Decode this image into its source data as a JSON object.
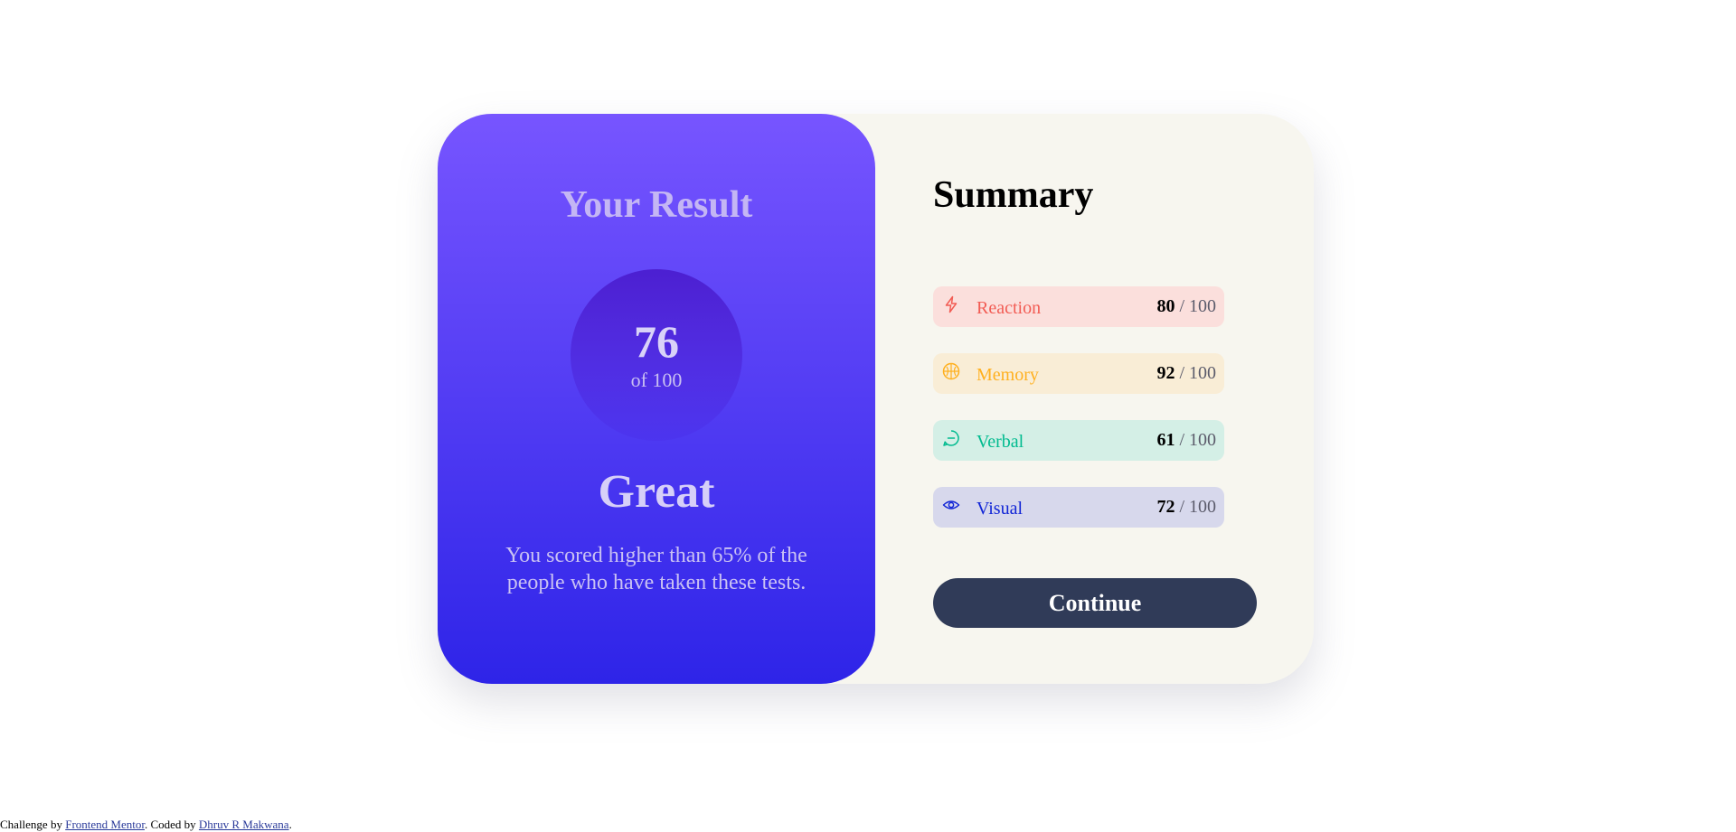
{
  "result": {
    "title": "Your Result",
    "score": "76",
    "total": "of 100",
    "rating": "Great",
    "description": "You scored higher than 65% of the people who have taken these tests."
  },
  "summary": {
    "title": "Summary",
    "items": [
      {
        "label": "Reaction",
        "score": "80",
        "max": " / 100",
        "icon": "lightning-icon",
        "color": "#f25c54",
        "bg": "#fbdfdc"
      },
      {
        "label": "Memory",
        "score": "92",
        "max": " / 100",
        "icon": "brain-icon",
        "color": "#ffb01f",
        "bg": "#f9edd6"
      },
      {
        "label": "Verbal",
        "score": "61",
        "max": " / 100",
        "icon": "chat-bubble-icon",
        "color": "#00bb8f",
        "bg": "#d4efe6"
      },
      {
        "label": "Visual",
        "score": "72",
        "max": " / 100",
        "icon": "eye-icon",
        "color": "#1125d6",
        "bg": "#d7d8ec"
      }
    ],
    "continue_label": "Continue"
  },
  "attribution": {
    "prefix": "Challenge by ",
    "challenge_link": "Frontend Mentor",
    "middle": ". Coded by ",
    "author_link": "Dhruv R Makwana",
    "suffix": "."
  }
}
